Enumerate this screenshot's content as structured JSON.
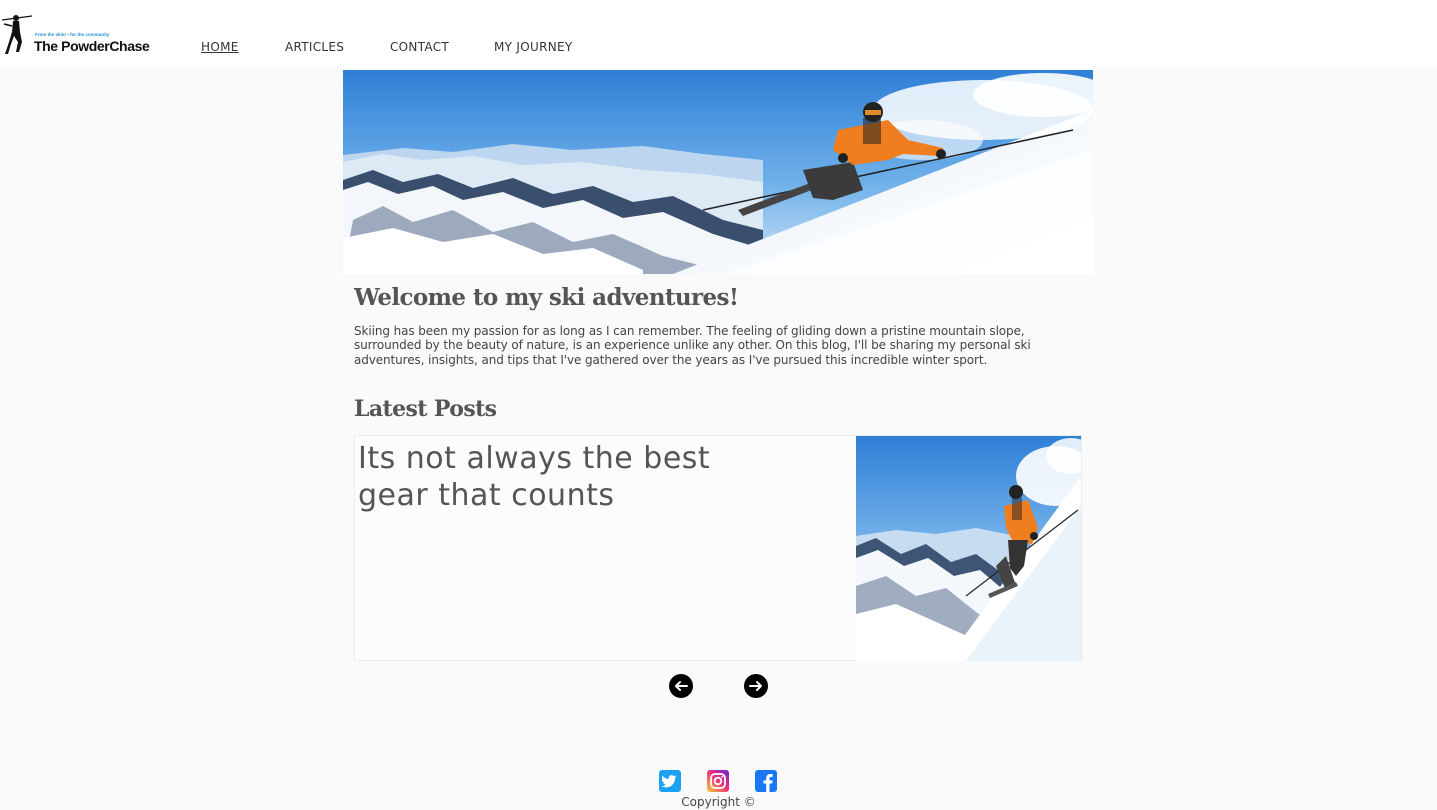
{
  "header": {
    "logo": {
      "tagline": "From the skier • for the community",
      "brand": "The PowderChase"
    },
    "nav": [
      {
        "label": "HOME",
        "active": true
      },
      {
        "label": "ARTICLES",
        "active": false
      },
      {
        "label": "CONTACT",
        "active": false
      },
      {
        "label": "MY JOURNEY",
        "active": false
      }
    ]
  },
  "main": {
    "welcome_title": "Welcome to my ski adventures!",
    "intro_text": "Skiing has been my passion for as long as I can remember. The feeling of gliding down a pristine mountain slope, surrounded by the beauty of nature, is an experience unlike any other. On this blog, I'll be sharing my personal ski adventures, insights, and tips that I've gathered over the years as I've pursued this incredible winter sport.",
    "latest_title": "Latest Posts",
    "post": {
      "title": "Its not always the best gear that counts"
    },
    "carousel": {
      "prev_icon": "arrow-left-icon",
      "next_icon": "arrow-right-icon"
    }
  },
  "footer": {
    "social": [
      {
        "icon": "twitter-icon",
        "color": "#1da1f2"
      },
      {
        "icon": "instagram-icon",
        "color": "#e1306c"
      },
      {
        "icon": "facebook-icon",
        "color": "#1877f2"
      }
    ],
    "copyright": "Copyright ©"
  },
  "colors": {
    "background": "#fafafa",
    "text": "#333333",
    "jacket": "#f07d1e",
    "sky": "#2f7fd6"
  }
}
